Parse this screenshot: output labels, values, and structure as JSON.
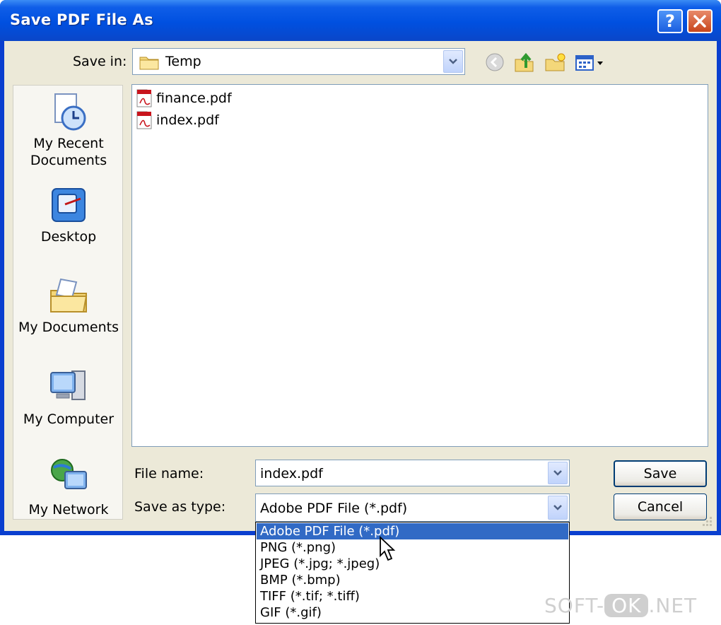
{
  "window": {
    "title": "Save PDF File As",
    "help_label": "?",
    "close_label": "✕"
  },
  "save_in": {
    "label": "Save in:",
    "value": "Temp"
  },
  "toolbar": {
    "icons": [
      "back-icon",
      "up-folder-icon",
      "new-folder-icon",
      "views-menu-icon"
    ]
  },
  "places": [
    {
      "label": "My Recent\nDocuments",
      "icon": "recent-documents-icon"
    },
    {
      "label": "Desktop",
      "icon": "desktop-icon"
    },
    {
      "label": "My Documents",
      "icon": "my-documents-icon"
    },
    {
      "label": "My Computer",
      "icon": "my-computer-icon"
    },
    {
      "label": "My Network",
      "icon": "my-network-icon"
    }
  ],
  "files": [
    {
      "name": "finance.pdf",
      "icon": "pdf-file-icon"
    },
    {
      "name": "index.pdf",
      "icon": "pdf-file-icon"
    }
  ],
  "file_name": {
    "label": "File name:",
    "value": "index.pdf"
  },
  "save_as_type": {
    "label": "Save as type:",
    "value": "Adobe PDF File (*.pdf)",
    "options": [
      "Adobe PDF File (*.pdf)",
      "PNG (*.png)",
      "JPEG (*.jpg; *.jpeg)",
      "BMP (*.bmp)",
      "TIFF (*.tif; *.tiff)",
      "GIF (*.gif)"
    ],
    "selected_index": 0
  },
  "buttons": {
    "save": "Save",
    "cancel": "Cancel"
  },
  "watermark": {
    "left": "SOFT-",
    "mid": "OK",
    "right": ".NET"
  },
  "colors": {
    "title_bar": "#0050e0",
    "selection": "#316ac5",
    "dialog_bg": "#ece9d8"
  }
}
